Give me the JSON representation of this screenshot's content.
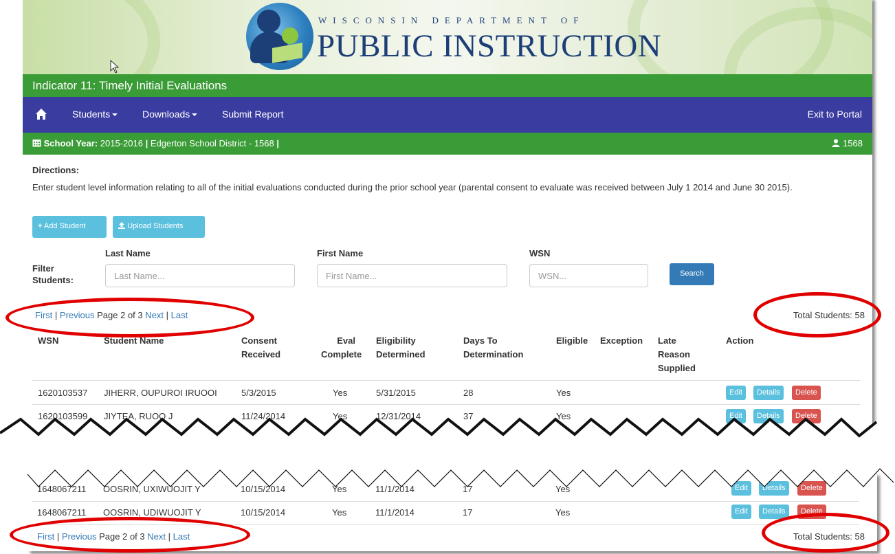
{
  "banner": {
    "line1": "WISCONSIN DEPARTMENT OF",
    "line2": "PUBLIC INSTRUCTION"
  },
  "title": "Indicator 11: Timely Initial Evaluations",
  "nav": {
    "students": "Students",
    "downloads": "Downloads",
    "submit": "Submit Report",
    "exit": "Exit to Portal"
  },
  "year_bar": {
    "label": "School Year:",
    "year": "2015-2016",
    "district": "Edgerton School District - 1568",
    "user": "1568"
  },
  "directions": {
    "heading": "Directions:",
    "text": "Enter student level information relating to all of the initial evaluations conducted during the prior school year (parental consent to evaluate was received between July 1 2014 and June 30 2015)."
  },
  "buttons": {
    "add": "Add Student",
    "upload": "Upload Students",
    "search": "Search"
  },
  "filter": {
    "label": "Filter Students:",
    "last_name_label": "Last Name",
    "last_name_placeholder": "Last Name...",
    "first_name_label": "First Name",
    "first_name_placeholder": "First Name...",
    "wsn_label": "WSN",
    "wsn_placeholder": "WSN..."
  },
  "pager": {
    "first": "First",
    "sep": "|",
    "previous": "Previous",
    "page": "Page 2 of 3",
    "next": "Next",
    "last": "Last",
    "total": "Total Students: 58"
  },
  "table": {
    "headers": [
      "WSN",
      "Student Name",
      "Consent Received",
      "Eval Complete",
      "Eligibility Determined",
      "Days To Determination",
      "Eligible",
      "Exception",
      "Late Reason Supplied",
      "Action"
    ],
    "rows": [
      {
        "wsn": "1620103537",
        "name": "JIHERR, OUPUROI IRUOOI",
        "consent": "5/3/2015",
        "eval": "Yes",
        "determined": "5/31/2015",
        "days": "28",
        "eligible": "Yes"
      },
      {
        "wsn": "1620103599",
        "name": "JIYTEA, RUOO J",
        "consent": "11/24/2014",
        "eval": "Yes",
        "determined": "12/31/2014",
        "days": "37",
        "eligible": "Yes"
      },
      {
        "wsn": "1648067211",
        "name": "OOSRIN, UXIWUOJIT Y",
        "consent": "10/15/2014",
        "eval": "Yes",
        "determined": "11/1/2014",
        "days": "17",
        "eligible": "Yes"
      },
      {
        "wsn": "1648067211",
        "name": "OOSRIN, UDIWUOJIT Y",
        "consent": "10/15/2014",
        "eval": "Yes",
        "determined": "11/1/2014",
        "days": "17",
        "eligible": "Yes"
      }
    ],
    "actions": {
      "edit": "Edit",
      "details": "Details",
      "delete": "Delete"
    }
  },
  "colors": {
    "green": "#3a9c36",
    "navy": "#3a3ca0",
    "info": "#5bc0de",
    "primary": "#337ab7",
    "danger": "#d9534f",
    "annotation": "#e00000"
  }
}
